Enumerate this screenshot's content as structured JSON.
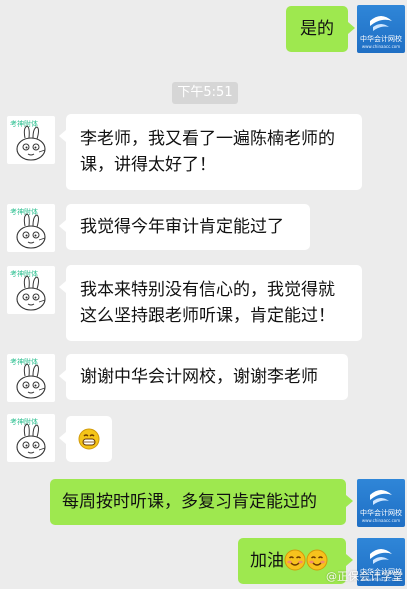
{
  "timestamp": "下午5:51",
  "messages": [
    {
      "side": "right",
      "lines": [
        "是的"
      ]
    },
    {
      "side": "left",
      "lines": [
        "李老师，我又看了一遍陈楠老师的",
        "课，讲得太好了！"
      ]
    },
    {
      "side": "left",
      "lines": [
        "我觉得今年审计肯定能过了"
      ]
    },
    {
      "side": "left",
      "lines": [
        "我本来特别没有信心的，我觉得就",
        "这么坚持跟老师听课，肯定能过！"
      ]
    },
    {
      "side": "left",
      "lines": [
        "谢谢中华会计网校，谢谢李老师"
      ]
    },
    {
      "side": "left",
      "emoji": "grinning-face-icon"
    },
    {
      "side": "right",
      "lines": [
        "每周按时听课，多复习肯定能过的"
      ]
    },
    {
      "side": "right",
      "text": "加油",
      "emoji": "blushing-smile-face-icon"
    }
  ],
  "right_avatar": {
    "icon": "chinaacc-logo-icon",
    "text": "中华会计网校",
    "subtext": "www.chinaacc.com"
  },
  "left_avatar": {
    "icon": "cartoon-bunny-icon",
    "caption": "考神附体"
  },
  "watermark": "@正保会计学堂",
  "colors": {
    "background": "#ececec",
    "sent_bubble": "#9ee84f",
    "received_bubble": "#ffffff",
    "timestamp_bg": "#d6d6d6"
  }
}
